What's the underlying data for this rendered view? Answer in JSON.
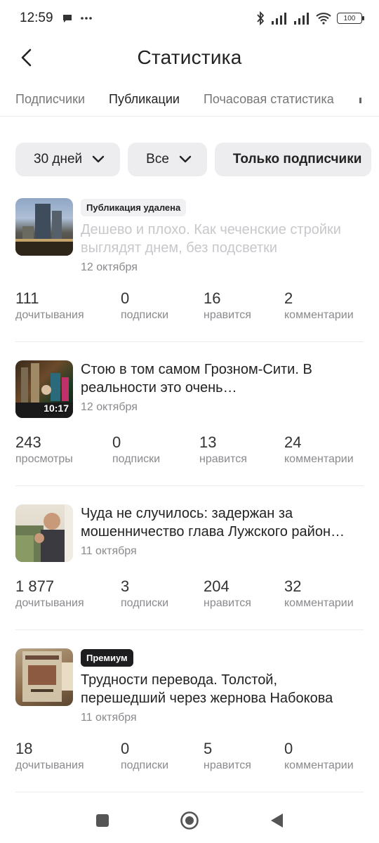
{
  "status_bar": {
    "time": "12:59",
    "battery": "100"
  },
  "header": {
    "title": "Статистика"
  },
  "tabs": [
    {
      "label": "Подписчики"
    },
    {
      "label": "Публикации"
    },
    {
      "label": "Почасовая статистика"
    }
  ],
  "filters": {
    "period": "30 дней",
    "type": "Все",
    "audience": "Только подписчики"
  },
  "posts": [
    {
      "badge": "Публикация удалена",
      "title": "Дешево и плохо. Как чеченские стройки выглядят днем, без подсветки",
      "date": "12 октября",
      "stats": [
        {
          "value": "111",
          "label": "дочитывания"
        },
        {
          "value": "0",
          "label": "подписки"
        },
        {
          "value": "16",
          "label": "нравится"
        },
        {
          "value": "2",
          "label": "комментарии"
        }
      ]
    },
    {
      "duration": "10:17",
      "title": "Стою в том самом Грозном-Сити. В реальности это очень…",
      "date": "12 октября",
      "stats": [
        {
          "value": "243",
          "label": "просмотры"
        },
        {
          "value": "0",
          "label": "подписки"
        },
        {
          "value": "13",
          "label": "нравится"
        },
        {
          "value": "24",
          "label": "комментарии"
        }
      ]
    },
    {
      "title": "Чуда не случилось: задержан за мошенничество глава Лужского район…",
      "date": "11 октября",
      "stats": [
        {
          "value": "1 877",
          "label": "дочитывания"
        },
        {
          "value": "3",
          "label": "подписки"
        },
        {
          "value": "204",
          "label": "нравится"
        },
        {
          "value": "32",
          "label": "комментарии"
        }
      ]
    },
    {
      "badge": "Премиум",
      "title": "Трудности перевода. Толстой, перешедший через жернова Набокова",
      "date": "11 октября",
      "stats": [
        {
          "value": "18",
          "label": "дочитывания"
        },
        {
          "value": "0",
          "label": "подписки"
        },
        {
          "value": "5",
          "label": "нравится"
        },
        {
          "value": "0",
          "label": "комментарии"
        }
      ]
    }
  ],
  "nav": {
    "recents": "square-icon",
    "home": "circle-icon",
    "back": "triangle-back-icon"
  },
  "colors": {
    "chip_bg": "#ededf0",
    "premium_badge": "#1d1d1f",
    "muted_title": "#c8c8cc"
  }
}
